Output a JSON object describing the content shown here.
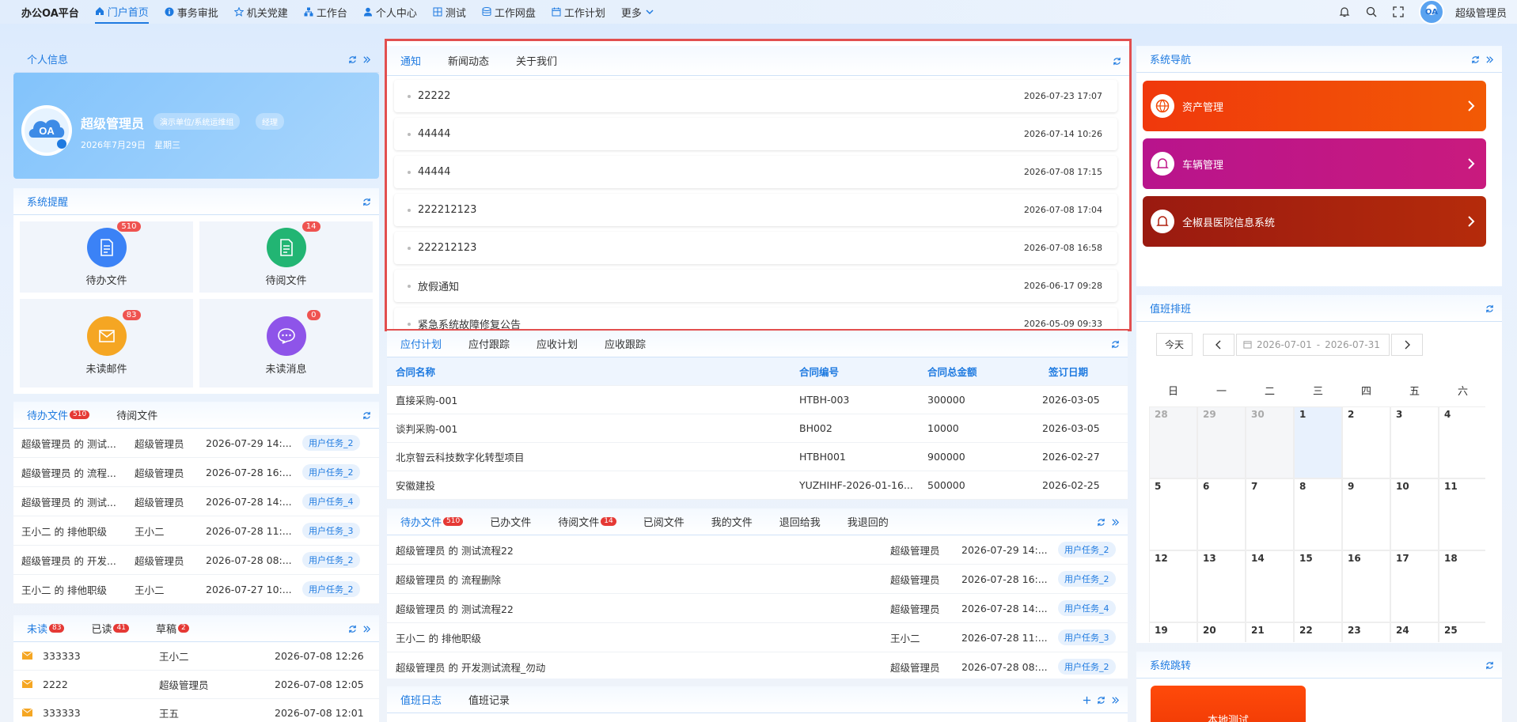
{
  "header": {
    "brand": "办公OA平台",
    "nav": [
      {
        "label": "门户首页",
        "icon": "home-icon"
      },
      {
        "label": "事务审批",
        "icon": "info-icon"
      },
      {
        "label": "机关党建",
        "icon": "star-icon"
      },
      {
        "label": "工作台",
        "icon": "workbench-icon"
      },
      {
        "label": "个人中心",
        "icon": "user-icon"
      },
      {
        "label": "测试",
        "icon": "grid-icon"
      },
      {
        "label": "工作网盘",
        "icon": "database-icon"
      },
      {
        "label": "工作计划",
        "icon": "calendar-icon"
      },
      {
        "label": "更多",
        "icon": "chevron-down-icon"
      }
    ],
    "avatar_text": "OA",
    "username": "超级管理员"
  },
  "personal": {
    "title": "个人信息",
    "name": "超级管理员",
    "tag1": "演示单位/系统运维组",
    "tag2": "经理",
    "date": "2026年7月29日　星期三",
    "avatar_text": "OA"
  },
  "reminder": {
    "title": "系统提醒",
    "items": [
      {
        "label": "待办文件",
        "count": "510",
        "color": "#3b82f6"
      },
      {
        "label": "待阅文件",
        "count": "14",
        "color": "#22b573"
      },
      {
        "label": "未读邮件",
        "count": "83",
        "color": "#f5a623"
      },
      {
        "label": "未读消息",
        "count": "0",
        "color": "#8e54e9"
      }
    ]
  },
  "todo_left": {
    "tabs": [
      {
        "label": "待办文件",
        "badge": "510"
      },
      {
        "label": "待阅文件",
        "badge": ""
      }
    ],
    "rows": [
      {
        "title": "超级管理员 的 测试...",
        "user": "超级管理员",
        "time": "2026-07-29 14:...",
        "task": "用户任务_2"
      },
      {
        "title": "超级管理员 的 流程...",
        "user": "超级管理员",
        "time": "2026-07-28 16:...",
        "task": "用户任务_2"
      },
      {
        "title": "超级管理员 的 测试...",
        "user": "超级管理员",
        "time": "2026-07-28 14:...",
        "task": "用户任务_4"
      },
      {
        "title": "王小二 的 排他职级",
        "user": "王小二",
        "time": "2026-07-28 11:...",
        "task": "用户任务_3"
      },
      {
        "title": "超级管理员 的 开发...",
        "user": "超级管理员",
        "time": "2026-07-28 08:...",
        "task": "用户任务_2"
      },
      {
        "title": "王小二 的 排他职级",
        "user": "王小二",
        "time": "2026-07-27 10:...",
        "task": "用户任务_2"
      }
    ]
  },
  "mail": {
    "tabs": [
      {
        "label": "未读",
        "badge": "83"
      },
      {
        "label": "已读",
        "badge": "41"
      },
      {
        "label": "草稿",
        "badge": "2"
      }
    ],
    "rows": [
      {
        "subject": "333333",
        "sender": "王小二",
        "time": "2026-07-08 12:26"
      },
      {
        "subject": "2222",
        "sender": "超级管理员",
        "time": "2026-07-08 12:05"
      },
      {
        "subject": "333333",
        "sender": "王五",
        "time": "2026-07-08 12:01"
      }
    ]
  },
  "notice": {
    "tabs": [
      "通知",
      "新闻动态",
      "关于我们"
    ],
    "rows": [
      {
        "title": "22222",
        "time": "2026-07-23 17:07"
      },
      {
        "title": "44444",
        "time": "2026-07-14 10:26"
      },
      {
        "title": "44444",
        "time": "2026-07-08 17:15"
      },
      {
        "title": "222212123",
        "time": "2026-07-08 17:04"
      },
      {
        "title": "222212123",
        "time": "2026-07-08 16:58"
      },
      {
        "title": "放假通知",
        "time": "2026-06-17 09:28"
      },
      {
        "title": "紧急系统故障修复公告",
        "time": "2026-05-09 09:33"
      }
    ]
  },
  "payment": {
    "tabs": [
      "应付计划",
      "应付跟踪",
      "应收计划",
      "应收跟踪"
    ],
    "columns": [
      "合同名称",
      "合同编号",
      "合同总金额",
      "签订日期"
    ],
    "rows": [
      [
        "直接采购-001",
        "HTBH-003",
        "300000",
        "2026-03-05"
      ],
      [
        "谈判采购-001",
        "BH002",
        "10000",
        "2026-03-05"
      ],
      [
        "北京智云科技数字化转型项目",
        "HTBH001",
        "900000",
        "2026-02-27"
      ],
      [
        "安徽建投",
        "YUZHIHF-2026-01-16...",
        "500000",
        "2026-02-25"
      ]
    ]
  },
  "todo_mid": {
    "tabs": [
      {
        "label": "待办文件",
        "badge": "510"
      },
      {
        "label": "已办文件",
        "badge": ""
      },
      {
        "label": "待阅文件",
        "badge": "14"
      },
      {
        "label": "已阅文件",
        "badge": ""
      },
      {
        "label": "我的文件",
        "badge": ""
      },
      {
        "label": "退回给我",
        "badge": ""
      },
      {
        "label": "我退回的",
        "badge": ""
      }
    ],
    "rows": [
      {
        "title": "超级管理员 的 测试流程22",
        "user": "超级管理员",
        "time": "2026-07-29 14:...",
        "task": "用户任务_2"
      },
      {
        "title": "超级管理员 的 流程删除",
        "user": "超级管理员",
        "time": "2026-07-28 16:...",
        "task": "用户任务_2"
      },
      {
        "title": "超级管理员 的 测试流程22",
        "user": "超级管理员",
        "time": "2026-07-28 14:...",
        "task": "用户任务_4"
      },
      {
        "title": "王小二 的 排他职级",
        "user": "王小二",
        "time": "2026-07-28 11:...",
        "task": "用户任务_3"
      },
      {
        "title": "超级管理员 的 开发测试流程_勿动",
        "user": "超级管理员",
        "time": "2026-07-28 08:...",
        "task": "用户任务_2"
      }
    ]
  },
  "duty_log": {
    "tabs": [
      "值班日志",
      "值班记录"
    ]
  },
  "sysnav": {
    "title": "系统导航",
    "items": [
      {
        "label": "资产管理",
        "color": "#f24a08",
        "icon": "basketball-icon"
      },
      {
        "label": "车辆管理",
        "color": "#c01488",
        "icon": "bell-icon"
      },
      {
        "label": "全椒县医院信息系统",
        "color": "#b0200e",
        "icon": "bell-icon"
      }
    ]
  },
  "duty": {
    "title": "值班排班",
    "today": "今天",
    "range_start": "2026-07-01",
    "range_sep": "-",
    "range_end": "2026-07-31",
    "weekdays": [
      "日",
      "一",
      "二",
      "三",
      "四",
      "五",
      "六"
    ],
    "days": [
      [
        "28",
        "29",
        "30",
        "1",
        "2",
        "3",
        "4"
      ],
      [
        "5",
        "6",
        "7",
        "8",
        "9",
        "10",
        "11"
      ],
      [
        "12",
        "13",
        "14",
        "15",
        "16",
        "17",
        "18"
      ],
      [
        "19",
        "20",
        "21",
        "22",
        "23",
        "24",
        "25"
      ]
    ]
  },
  "jump": {
    "title": "系统跳转",
    "item": "本地测试"
  }
}
